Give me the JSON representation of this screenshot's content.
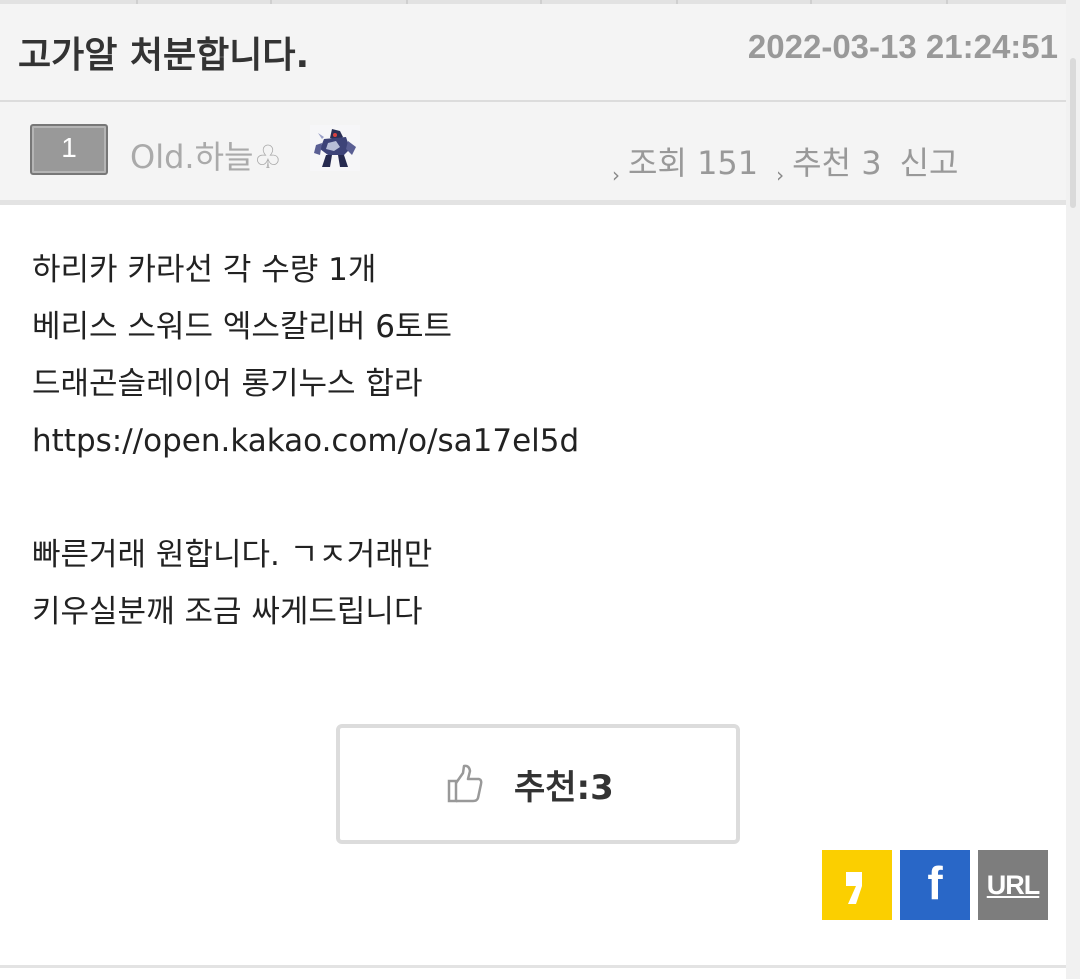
{
  "post": {
    "title": "고가알 처분합니다.",
    "datetime": "2022-03-13 21:24:51"
  },
  "author": {
    "level": "1",
    "nickname": "Old.하늘♧"
  },
  "stats": {
    "views_label": "조회",
    "views": "151",
    "recommend_label": "추천",
    "recommend": "3",
    "report_label": "신고"
  },
  "content": {
    "lines": [
      "하리카 카라선 각 수량 1개",
      "베리스 스워드 엑스칼리버 6토트",
      "드래곤슬레이어 롱기누스 합라",
      "https://open.kakao.com/o/sa17el5d",
      "",
      "빠른거래 원합니다. ㄱㅈ거래만",
      "키우실분깨 조금 싸게드립니다"
    ]
  },
  "recommend_button": {
    "label": "추천:3"
  },
  "share": {
    "kakao_glyph": "❜",
    "facebook_glyph": "f",
    "url_label": "URL",
    "colors": {
      "kakao": "#fbcf00",
      "facebook": "#2967c7",
      "url": "#7d7d7d"
    }
  }
}
